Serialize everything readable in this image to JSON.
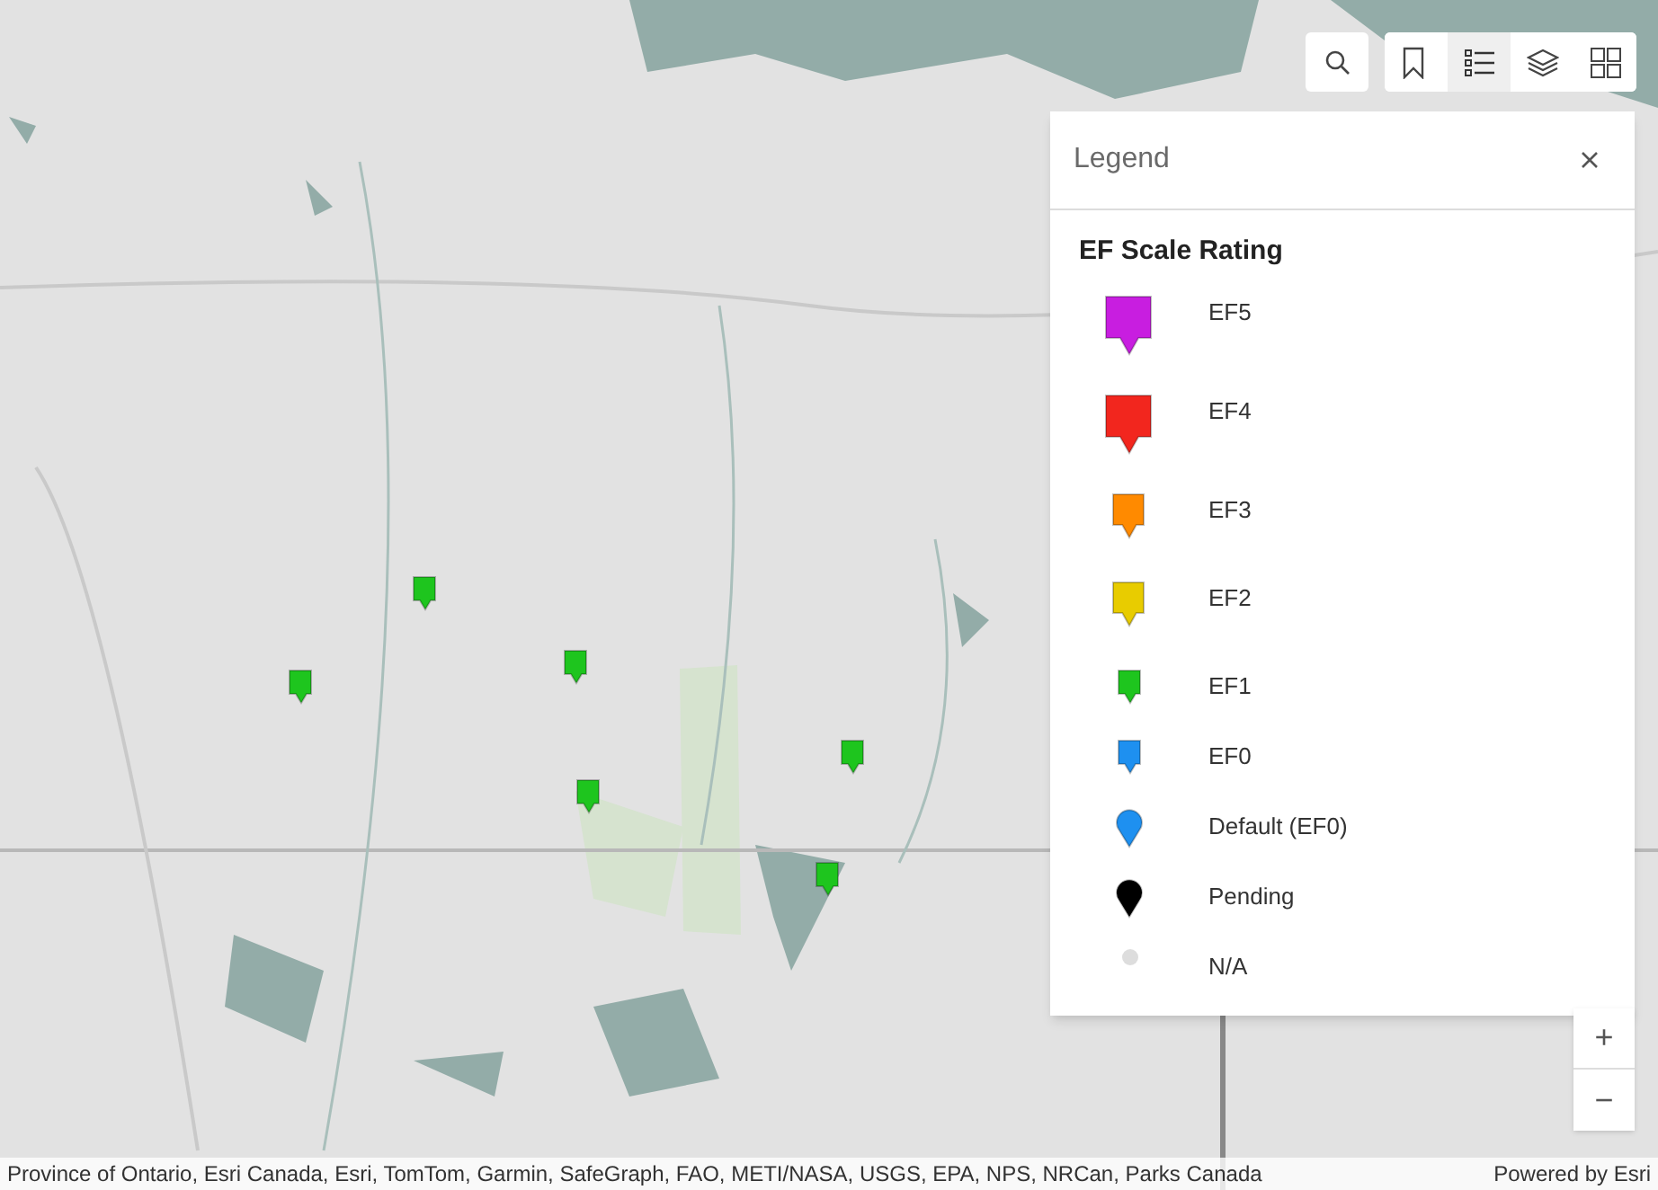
{
  "toolbar": {
    "tools": [
      {
        "kind": "bookmarks",
        "selected": false
      },
      {
        "kind": "legend",
        "selected": true
      },
      {
        "kind": "layers",
        "selected": false
      },
      {
        "kind": "basemap",
        "selected": false
      }
    ]
  },
  "map_markers": [
    {
      "color": "#1ec51e"
    },
    {
      "color": "#1ec51e"
    },
    {
      "color": "#1ec51e"
    },
    {
      "color": "#1ec51e"
    },
    {
      "color": "#1ec51e"
    },
    {
      "color": "#1ec51e"
    }
  ],
  "legend": {
    "title": "Legend",
    "layer_title": "EF Scale Rating",
    "items": [
      {
        "label": "EF5",
        "kind": "large",
        "color": "#c81ee0"
      },
      {
        "label": "EF4",
        "kind": "large",
        "color": "#f2261e"
      },
      {
        "label": "EF3",
        "kind": "medium",
        "color": "#ff8a00"
      },
      {
        "label": "EF2",
        "kind": "medium",
        "color": "#e8cc00"
      },
      {
        "label": "EF1",
        "kind": "small",
        "color": "#1ec51e"
      },
      {
        "label": "EF0",
        "kind": "small",
        "color": "#1e90f0"
      },
      {
        "label": "Default (EF0)",
        "kind": "round",
        "color": "#1e90f0"
      },
      {
        "label": "Pending",
        "kind": "round",
        "color": "#000000"
      },
      {
        "label": "N/A",
        "kind": "dot",
        "color": "#dddddd"
      }
    ]
  },
  "zoom": {
    "in": "+",
    "out": "−"
  },
  "attribution": "Province of Ontario, Esri Canada, Esri, TomTom, Garmin, SafeGraph, FAO, METI/NASA, USGS, EPA, NPS, NRCan, Parks Canada",
  "powered_by": "Powered by Esri"
}
